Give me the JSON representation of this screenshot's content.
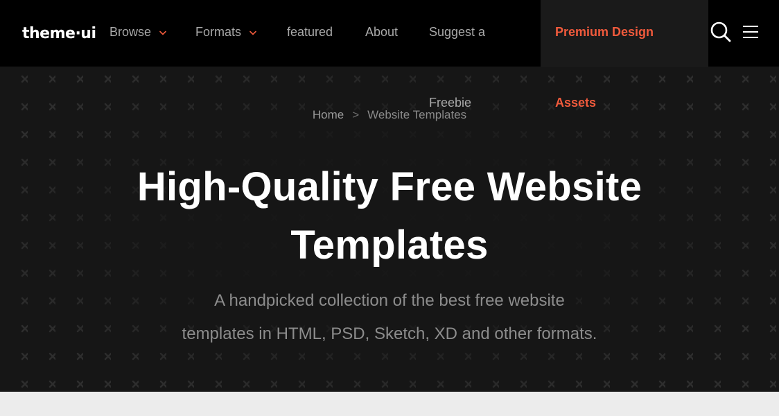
{
  "site": {
    "logo_text": "theme·ui"
  },
  "nav": {
    "browse_label": "Browse",
    "formats_label": "Formats",
    "featured_label": "featured",
    "about_label": "About",
    "suggest_line1": "Suggest a",
    "suggest_line2": "Freebie",
    "premium_line1": "Premium Design",
    "premium_line2": "Assets"
  },
  "icons": {
    "search": "search-icon",
    "menu": "hamburger-menu-icon",
    "browse_chevron": "chevron-down-icon",
    "formats_chevron": "chevron-down-icon"
  },
  "breadcrumb": {
    "home": "Home",
    "separator": ">",
    "current": "Website Templates"
  },
  "hero": {
    "title_line1": "High-Quality Free Website",
    "title_line2": "Templates",
    "subtitle_line1": "A handpicked collection of the best free website",
    "subtitle_line2": "templates in HTML, PSD, Sketch, XD and other formats."
  },
  "colors": {
    "accent": "#f05a3c",
    "nav_bg": "#000000",
    "hero_bg": "#161616",
    "page_bg": "#ececec"
  }
}
